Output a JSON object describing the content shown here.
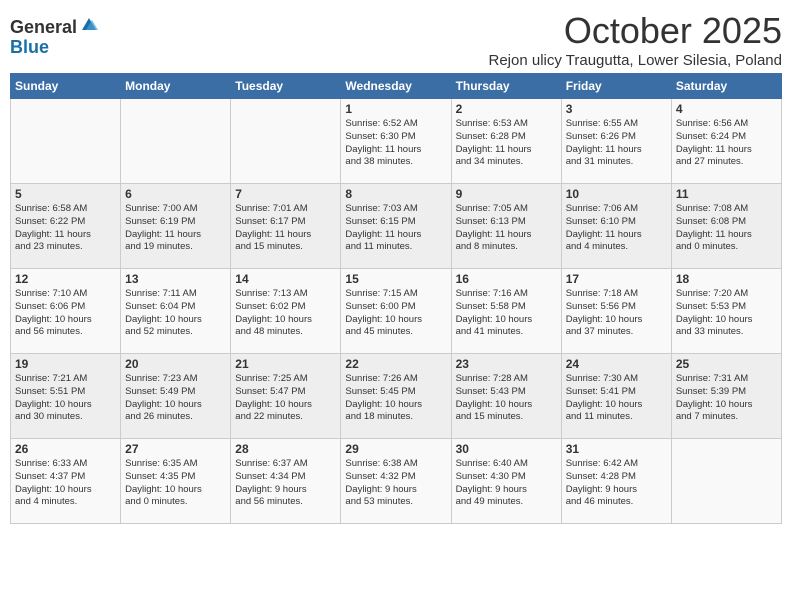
{
  "logo": {
    "general": "General",
    "blue": "Blue"
  },
  "header": {
    "month": "October 2025",
    "location": "Rejon ulicy Traugutta, Lower Silesia, Poland"
  },
  "days_of_week": [
    "Sunday",
    "Monday",
    "Tuesday",
    "Wednesday",
    "Thursday",
    "Friday",
    "Saturday"
  ],
  "weeks": [
    [
      {
        "day": "",
        "content": ""
      },
      {
        "day": "",
        "content": ""
      },
      {
        "day": "",
        "content": ""
      },
      {
        "day": "1",
        "content": "Sunrise: 6:52 AM\nSunset: 6:30 PM\nDaylight: 11 hours\nand 38 minutes."
      },
      {
        "day": "2",
        "content": "Sunrise: 6:53 AM\nSunset: 6:28 PM\nDaylight: 11 hours\nand 34 minutes."
      },
      {
        "day": "3",
        "content": "Sunrise: 6:55 AM\nSunset: 6:26 PM\nDaylight: 11 hours\nand 31 minutes."
      },
      {
        "day": "4",
        "content": "Sunrise: 6:56 AM\nSunset: 6:24 PM\nDaylight: 11 hours\nand 27 minutes."
      }
    ],
    [
      {
        "day": "5",
        "content": "Sunrise: 6:58 AM\nSunset: 6:22 PM\nDaylight: 11 hours\nand 23 minutes."
      },
      {
        "day": "6",
        "content": "Sunrise: 7:00 AM\nSunset: 6:19 PM\nDaylight: 11 hours\nand 19 minutes."
      },
      {
        "day": "7",
        "content": "Sunrise: 7:01 AM\nSunset: 6:17 PM\nDaylight: 11 hours\nand 15 minutes."
      },
      {
        "day": "8",
        "content": "Sunrise: 7:03 AM\nSunset: 6:15 PM\nDaylight: 11 hours\nand 11 minutes."
      },
      {
        "day": "9",
        "content": "Sunrise: 7:05 AM\nSunset: 6:13 PM\nDaylight: 11 hours\nand 8 minutes."
      },
      {
        "day": "10",
        "content": "Sunrise: 7:06 AM\nSunset: 6:10 PM\nDaylight: 11 hours\nand 4 minutes."
      },
      {
        "day": "11",
        "content": "Sunrise: 7:08 AM\nSunset: 6:08 PM\nDaylight: 11 hours\nand 0 minutes."
      }
    ],
    [
      {
        "day": "12",
        "content": "Sunrise: 7:10 AM\nSunset: 6:06 PM\nDaylight: 10 hours\nand 56 minutes."
      },
      {
        "day": "13",
        "content": "Sunrise: 7:11 AM\nSunset: 6:04 PM\nDaylight: 10 hours\nand 52 minutes."
      },
      {
        "day": "14",
        "content": "Sunrise: 7:13 AM\nSunset: 6:02 PM\nDaylight: 10 hours\nand 48 minutes."
      },
      {
        "day": "15",
        "content": "Sunrise: 7:15 AM\nSunset: 6:00 PM\nDaylight: 10 hours\nand 45 minutes."
      },
      {
        "day": "16",
        "content": "Sunrise: 7:16 AM\nSunset: 5:58 PM\nDaylight: 10 hours\nand 41 minutes."
      },
      {
        "day": "17",
        "content": "Sunrise: 7:18 AM\nSunset: 5:56 PM\nDaylight: 10 hours\nand 37 minutes."
      },
      {
        "day": "18",
        "content": "Sunrise: 7:20 AM\nSunset: 5:53 PM\nDaylight: 10 hours\nand 33 minutes."
      }
    ],
    [
      {
        "day": "19",
        "content": "Sunrise: 7:21 AM\nSunset: 5:51 PM\nDaylight: 10 hours\nand 30 minutes."
      },
      {
        "day": "20",
        "content": "Sunrise: 7:23 AM\nSunset: 5:49 PM\nDaylight: 10 hours\nand 26 minutes."
      },
      {
        "day": "21",
        "content": "Sunrise: 7:25 AM\nSunset: 5:47 PM\nDaylight: 10 hours\nand 22 minutes."
      },
      {
        "day": "22",
        "content": "Sunrise: 7:26 AM\nSunset: 5:45 PM\nDaylight: 10 hours\nand 18 minutes."
      },
      {
        "day": "23",
        "content": "Sunrise: 7:28 AM\nSunset: 5:43 PM\nDaylight: 10 hours\nand 15 minutes."
      },
      {
        "day": "24",
        "content": "Sunrise: 7:30 AM\nSunset: 5:41 PM\nDaylight: 10 hours\nand 11 minutes."
      },
      {
        "day": "25",
        "content": "Sunrise: 7:31 AM\nSunset: 5:39 PM\nDaylight: 10 hours\nand 7 minutes."
      }
    ],
    [
      {
        "day": "26",
        "content": "Sunrise: 6:33 AM\nSunset: 4:37 PM\nDaylight: 10 hours\nand 4 minutes."
      },
      {
        "day": "27",
        "content": "Sunrise: 6:35 AM\nSunset: 4:35 PM\nDaylight: 10 hours\nand 0 minutes."
      },
      {
        "day": "28",
        "content": "Sunrise: 6:37 AM\nSunset: 4:34 PM\nDaylight: 9 hours\nand 56 minutes."
      },
      {
        "day": "29",
        "content": "Sunrise: 6:38 AM\nSunset: 4:32 PM\nDaylight: 9 hours\nand 53 minutes."
      },
      {
        "day": "30",
        "content": "Sunrise: 6:40 AM\nSunset: 4:30 PM\nDaylight: 9 hours\nand 49 minutes."
      },
      {
        "day": "31",
        "content": "Sunrise: 6:42 AM\nSunset: 4:28 PM\nDaylight: 9 hours\nand 46 minutes."
      },
      {
        "day": "",
        "content": ""
      }
    ]
  ]
}
